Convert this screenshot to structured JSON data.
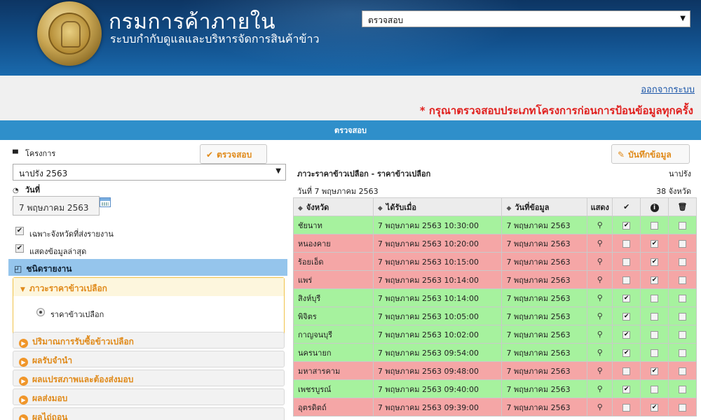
{
  "header": {
    "dept_title": "กรมการค้าภายใน",
    "system_title": "ระบบกำกับดูแลและบริหารจัดการสินค้าข้าว",
    "top_select_value": "ตรวจสอบ"
  },
  "topbar": {
    "logout_label": "ออกจากระบบ",
    "warning": "* กรุณาตรวจสอบประเภทโครงการก่อนการป้อนข้อมูลทุกครั้ง"
  },
  "section_title": "ตรวจสอบ",
  "left": {
    "project_label": "โครงการ",
    "check_button": "ตรวจสอบ",
    "project_value": "นาปรัง 2563",
    "date_label": "วันที่",
    "date_value": "7 พฤษภาคม 2563",
    "checkbox_reported": "เฉพาะจังหวัดที่ส่งรายงาน",
    "checkbox_latest": "แสดงข้อมูลล่าสุด",
    "report_type_label": "ชนิดรายงาน",
    "open_group": "ภาวะราคาข้าวเปลือก",
    "radio_option": "ราคาข้าวเปลือก",
    "groups": [
      "ปริมาณการรับซื้อข้าวเปลือก",
      "ผลรับจำนำ",
      "ผลแปรสภาพและต้องส่งมอบ",
      "ผลส่งมอบ",
      "ผลไถ่ถอน"
    ]
  },
  "right": {
    "save_button": "บันทึกข้อมูล",
    "report_title": "ภาวะราคาข้าวเปลือก - ราคาข้าวเปลือก",
    "project": "นาปรัง",
    "date_line": "วันที่ 7 พฤษภาคม 2563",
    "count": "38 จังหวัด",
    "columns": {
      "province": "จังหวัด",
      "received": "ได้รับเมื่อ",
      "data_date": "วันที่ข้อมูล",
      "show": "แสดง"
    },
    "rows": [
      {
        "province": "ชัยนาท",
        "received": "7 พฤษภาคม 2563 10:30:00",
        "data_date": "7 พฤษภาคม 2563",
        "status": "ok",
        "checked": true,
        "info": false,
        "delete": false
      },
      {
        "province": "หนองคาย",
        "received": "7 พฤษภาคม 2563 10:20:00",
        "data_date": "7 พฤษภาคม 2563",
        "status": "bad",
        "checked": false,
        "info": true,
        "delete": false
      },
      {
        "province": "ร้อยเอ็ด",
        "received": "7 พฤษภาคม 2563 10:15:00",
        "data_date": "7 พฤษภาคม 2563",
        "status": "bad",
        "checked": false,
        "info": true,
        "delete": false
      },
      {
        "province": "แพร่",
        "received": "7 พฤษภาคม 2563 10:14:00",
        "data_date": "7 พฤษภาคม 2563",
        "status": "bad",
        "checked": false,
        "info": true,
        "delete": false
      },
      {
        "province": "สิงห์บุรี",
        "received": "7 พฤษภาคม 2563 10:14:00",
        "data_date": "7 พฤษภาคม 2563",
        "status": "ok",
        "checked": true,
        "info": false,
        "delete": false
      },
      {
        "province": "พิจิตร",
        "received": "7 พฤษภาคม 2563 10:05:00",
        "data_date": "7 พฤษภาคม 2563",
        "status": "ok",
        "checked": true,
        "info": false,
        "delete": false
      },
      {
        "province": "กาญจนบุรี",
        "received": "7 พฤษภาคม 2563 10:02:00",
        "data_date": "7 พฤษภาคม 2563",
        "status": "ok",
        "checked": true,
        "info": false,
        "delete": false
      },
      {
        "province": "นครนายก",
        "received": "7 พฤษภาคม 2563 09:54:00",
        "data_date": "7 พฤษภาคม 2563",
        "status": "ok",
        "checked": true,
        "info": false,
        "delete": false
      },
      {
        "province": "มหาสารคาม",
        "received": "7 พฤษภาคม 2563 09:48:00",
        "data_date": "7 พฤษภาคม 2563",
        "status": "bad",
        "checked": false,
        "info": true,
        "delete": false
      },
      {
        "province": "เพชรบูรณ์",
        "received": "7 พฤษภาคม 2563 09:40:00",
        "data_date": "7 พฤษภาคม 2563",
        "status": "ok",
        "checked": true,
        "info": false,
        "delete": false
      },
      {
        "province": "อุตรดิตถ์",
        "received": "7 พฤษภาคม 2563 09:39:00",
        "data_date": "7 พฤษภาคม 2563",
        "status": "bad",
        "checked": false,
        "info": true,
        "delete": false
      }
    ]
  },
  "colors": {
    "header_dark": "#0d3563",
    "accent_blue": "#2f8fca",
    "row_ok": "#a6f29e",
    "row_bad": "#f5a6a6",
    "orange": "#e08a1a",
    "warning_red": "#e0201e"
  },
  "icons": [
    "seal-logo",
    "folder-icon",
    "clock-icon",
    "calendar-icon",
    "check-icon",
    "pencil-icon",
    "magnifier-icon",
    "info-icon",
    "trash-icon",
    "sort-icon"
  ]
}
